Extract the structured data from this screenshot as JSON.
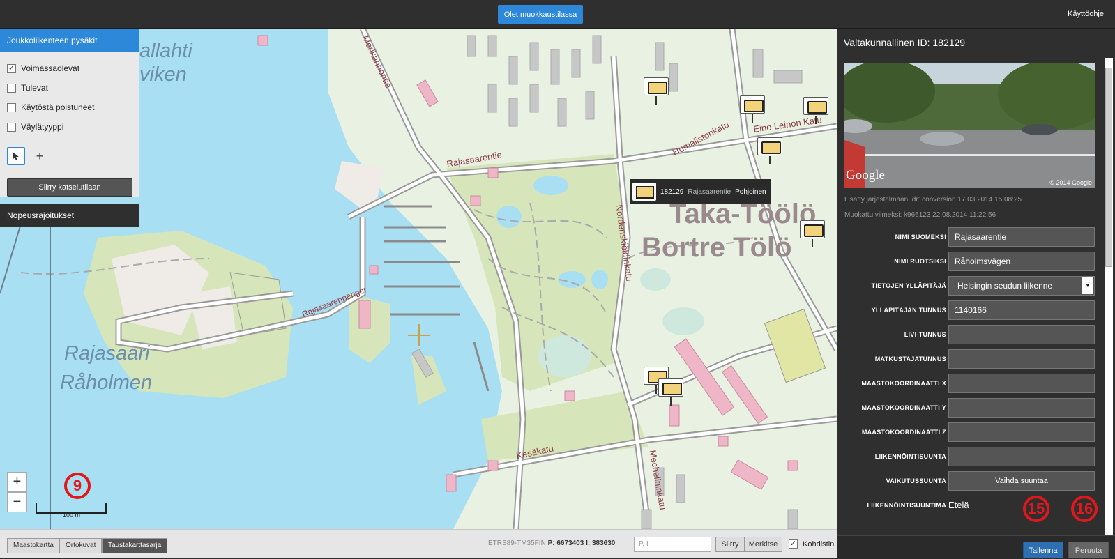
{
  "topbar": {
    "edit_mode_label": "Olet muokkaustilassa",
    "help_label": "Käyttöohje"
  },
  "left_panel": {
    "header": "Joukkoliikenteen pysäkit",
    "filters": [
      {
        "label": "Voimassaolevat",
        "checked": true
      },
      {
        "label": "Tulevat",
        "checked": false
      },
      {
        "label": "Käytöstä poistuneet",
        "checked": false
      },
      {
        "label": "Väylätyyppi",
        "checked": false
      }
    ],
    "view_mode_button": "Siirry katselutilaan",
    "speed_limits": "Nopeusrajoitukset"
  },
  "map": {
    "district_labels": [
      "Taka-Töölö",
      "Bortre Tölö"
    ],
    "island_labels": [
      "Rajasaari",
      "Råholmen"
    ],
    "water_labels": [
      "allahti",
      "viken"
    ],
    "street_labels": [
      "Rajasaarentie",
      "Rajasaarenpenger",
      "Kesäkatu",
      "Mechelininkatu",
      "Humalistonkatu",
      "Eino Leinon Katu",
      "Merikannontie",
      "Nordenskiöldinkatu"
    ],
    "tooltip": {
      "id": "182129",
      "street": "Rajasaarentie",
      "direction": "Pohjoinen"
    },
    "zoom_in": "+",
    "zoom_out": "−",
    "scale_label": "100 m",
    "annotation_zoom": "9"
  },
  "bottom_bar": {
    "layers": [
      {
        "label": "Maastokartta",
        "active": false
      },
      {
        "label": "Ortokuvat",
        "active": false
      },
      {
        "label": "Taustakarttasarja",
        "active": true
      }
    ],
    "crs": "ETRS89-TM35FIN",
    "coord_p_label": "P:",
    "coord_p": "6673403",
    "coord_i_label": "I:",
    "coord_i": "383630",
    "search_placeholder": "P, I",
    "move_button": "Siirry",
    "mark_button": "Merkitse",
    "crosshair_label": "Kohdistin",
    "crosshair_checked": true
  },
  "right_panel": {
    "title": "Valtakunnallinen ID: 182129",
    "photo_brand": "Google",
    "photo_copyright": "© 2014 Google",
    "added": "Lisätty järjestelmään: dr1conversion 17.03.2014 15:08:25",
    "modified": "Muokattu viimeksi: k966123 22.08.2014 11:22:56",
    "fields": [
      {
        "label": "NIMI SUOMEKSI",
        "value": "Rajasaarentie"
      },
      {
        "label": "NIMI RUOTSIKSI",
        "value": "Råholmsvägen"
      },
      {
        "label": "TIETOJEN YLLÄPITÄJÄ",
        "value": "Helsingin seudun liikenne"
      },
      {
        "label": "YLLÄPITÄJÄN TUNNUS",
        "value": "1140166"
      },
      {
        "label": "LIVI-TUNNUS",
        "value": ""
      },
      {
        "label": "MATKUSTAJATUNNUS",
        "value": ""
      },
      {
        "label": "MAASTOKOORDINAATTI X",
        "value": ""
      },
      {
        "label": "MAASTOKOORDINAATTI Y",
        "value": ""
      },
      {
        "label": "MAASTOKOORDINAATTI Z",
        "value": ""
      },
      {
        "label": "LIIKENNÖINTISUUNTA",
        "value": ""
      },
      {
        "label": "VAIKUTUSSUUNTA",
        "value": "Vaihda suuntaa"
      },
      {
        "label": "LIIKENNÖINTISUUNTIMA",
        "value": "Etelä"
      }
    ],
    "save_button": "Tallenna",
    "cancel_button": "Peruuta",
    "annotation_save": "15",
    "annotation_cancel": "16"
  }
}
